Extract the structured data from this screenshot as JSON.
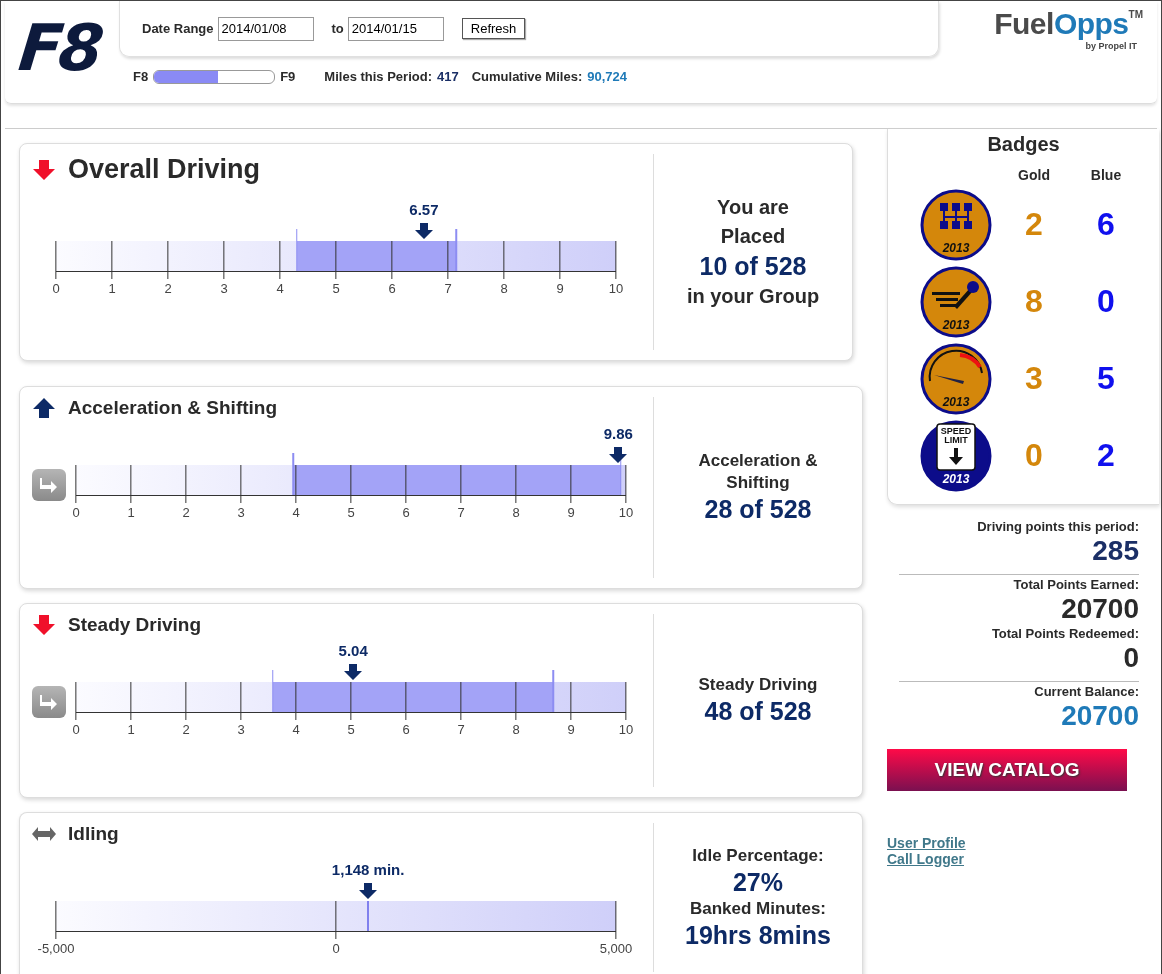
{
  "header": {
    "logo": "F8",
    "date_range_label": "Date Range",
    "date_from": "2014/01/08",
    "to_label": "to",
    "date_to": "2014/01/15",
    "refresh_button": "Refresh",
    "level_from": "F8",
    "level_to": "F9",
    "level_progress": {
      "level": 0.53
    },
    "miles_label": "Miles this Period:",
    "miles_value": "417",
    "cumulative_label": "Cumulative Miles:",
    "cumulative_value": "90,724",
    "brand": {
      "part_1": "Fuel",
      "part_2": "Opps",
      "trademark": "TM",
      "tagline": "by Propel IT"
    }
  },
  "panels": [
    {
      "kind": "overall",
      "title": "Overall Driving",
      "trend": {
        "kind": "down"
      },
      "jump_button": false,
      "summary": [
        {
          "text": "You are",
          "kind": "label"
        },
        {
          "text": "Placed",
          "kind": "label"
        },
        {
          "text": "10 of 528",
          "kind": "value"
        },
        {
          "text": "in your Group",
          "kind": "label"
        }
      ],
      "gauge": {
        "scale": [
          "0",
          "1",
          "2",
          "3",
          "4",
          "5",
          "6",
          "7",
          "8",
          "9",
          "10"
        ],
        "range_low": {
          "level": 0.43
        },
        "range_high": {
          "level": 0.715
        },
        "marker": {
          "label": "6.57",
          "level": 0.657
        }
      }
    },
    {
      "kind": "category",
      "title": "Acceleration & Shifting",
      "trend": {
        "kind": "up"
      },
      "jump_button": true,
      "summary": [
        {
          "text": "Acceleration &",
          "kind": "label"
        },
        {
          "text": "Shifting",
          "kind": "label"
        },
        {
          "text": "28 of 528",
          "kind": "value"
        }
      ],
      "gauge": {
        "scale": [
          "0",
          "1",
          "2",
          "3",
          "4",
          "5",
          "6",
          "7",
          "8",
          "9",
          "10"
        ],
        "range_low": {
          "level": 0.395
        },
        "range_high": {
          "level": 0.99
        },
        "marker": {
          "label": "9.86",
          "level": 0.986
        }
      }
    },
    {
      "kind": "category",
      "title": "Steady Driving",
      "trend": {
        "kind": "down"
      },
      "jump_button": true,
      "summary": [
        {
          "text": "Steady Driving",
          "kind": "label"
        },
        {
          "text": "48 of 528",
          "kind": "value"
        }
      ],
      "gauge": {
        "scale": [
          "0",
          "1",
          "2",
          "3",
          "4",
          "5",
          "6",
          "7",
          "8",
          "9",
          "10"
        ],
        "range_low": {
          "level": 0.358
        },
        "range_high": {
          "level": 0.868
        },
        "marker": {
          "label": "5.04",
          "level": 0.504
        }
      }
    },
    {
      "kind": "category",
      "title": "Idling",
      "trend": {
        "kind": "neutral"
      },
      "jump_button": false,
      "summary": [
        {
          "text": "Idle Percentage:",
          "kind": "label"
        },
        {
          "text": "27%",
          "kind": "value"
        },
        {
          "text": "Banked Minutes:",
          "kind": "label"
        },
        {
          "text": "19hrs 8mins",
          "kind": "value"
        }
      ],
      "gauge": {
        "scale": [
          "-5,000",
          "0",
          "5,000"
        ],
        "marker": {
          "label": "1,148 min.",
          "level": 0.5574,
          "line": true
        }
      }
    }
  ],
  "badges": {
    "title": "Badges",
    "columns": [
      "Gold",
      "Blue"
    ],
    "rows": [
      {
        "kind": "shifter",
        "year": "2013",
        "gold": "2",
        "blue": "6"
      },
      {
        "kind": "pedal",
        "year": "2013",
        "gold": "8",
        "blue": "0"
      },
      {
        "kind": "gauge",
        "year": "2013",
        "gold": "3",
        "blue": "5"
      },
      {
        "kind": "speed-limit",
        "year": "2013",
        "sign_lines": [
          "SPEED",
          "LIMIT"
        ],
        "gold": "0",
        "blue": "2"
      }
    ]
  },
  "points": [
    {
      "label": "Driving points this period:",
      "value": "285",
      "color": "#1b2f66"
    },
    {
      "label": "Total Points Earned:",
      "value": "20700",
      "color": "#2a2a2a",
      "divider_above": true
    },
    {
      "label": "Total Points Redeemed:",
      "value": "0",
      "color": "#2a2a2a"
    },
    {
      "label": "Current Balance:",
      "value": "20700",
      "color": "#1f7ab8",
      "divider_above": true
    }
  ],
  "catalog_button": "VIEW CATALOG",
  "links": [
    "User Profile",
    "Call Logger"
  ]
}
